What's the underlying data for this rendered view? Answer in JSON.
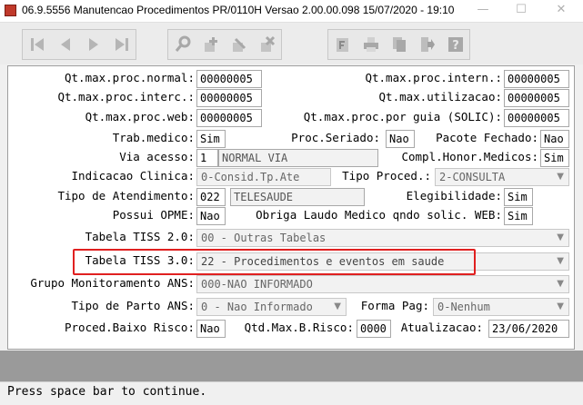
{
  "window": {
    "title": "06.9.5556 Manutencao  Procedimentos PR/0110H Versao 2.00.00.098 15/07/2020 - 19:10",
    "minimize_glyph": "—",
    "maximize_glyph": "☐",
    "close_glyph": "✕"
  },
  "toolbar": {
    "nav_icons": [
      "first-icon",
      "previous-icon",
      "next-icon",
      "last-icon"
    ],
    "edit_icons": [
      "search-icon",
      "add-icon",
      "edit-icon",
      "delete-icon"
    ],
    "action_icons": [
      "filter-icon",
      "print-icon",
      "copy-icon",
      "exit-icon",
      "help-icon"
    ]
  },
  "form": {
    "qt_max_normal": {
      "label": "Qt.max.proc.normal:",
      "value": "00000005"
    },
    "qt_max_intern": {
      "label": "Qt.max.proc.intern.:",
      "value": "00000005"
    },
    "qt_max_interc": {
      "label": "Qt.max.proc.interc.:",
      "value": "00000005"
    },
    "qt_max_utilizacao": {
      "label": "Qt.max.utilizacao:",
      "value": "00000005"
    },
    "qt_max_web": {
      "label": "Qt.max.proc.web:",
      "value": "00000005"
    },
    "qt_max_guia": {
      "label": "Qt.max.proc.por guia (SOLIC):",
      "value": "00000005"
    },
    "trab_medico": {
      "label": "Trab.medico:",
      "value": "Sim"
    },
    "proc_seriado": {
      "label": "Proc.Seriado:",
      "value": "Nao"
    },
    "pacote_fechado": {
      "label": "Pacote Fechado:",
      "value": "Nao"
    },
    "via_acesso": {
      "label": "Via acesso:",
      "code": "1",
      "desc": "NORMAL VIA"
    },
    "compl_honor": {
      "label": "Compl.Honor.Medicos:",
      "value": "Sim"
    },
    "indicacao_clinica": {
      "label": "Indicacao Clinica:",
      "value": "0-Consid.Tp.Ate"
    },
    "tipo_proced": {
      "label": "Tipo Proced.:",
      "value": "2-CONSULTA"
    },
    "tipo_atendimento": {
      "label": "Tipo de Atendimento:",
      "code": "022",
      "desc": "TELESAUDE"
    },
    "elegibilidade": {
      "label": "Elegibilidade:",
      "value": "Sim"
    },
    "possui_opme": {
      "label": "Possui OPME:",
      "value": "Nao"
    },
    "obriga_laudo": {
      "label": "Obriga Laudo Medico qndo solic. WEB:",
      "value": "Sim"
    },
    "tabela_tiss2": {
      "label": "Tabela TISS 2.0:",
      "value": "00 - Outras Tabelas"
    },
    "tabela_tiss3": {
      "label": "Tabela TISS 3.0:",
      "value": "22 - Procedimentos e eventos em saude"
    },
    "grupo_monitoramento": {
      "label": "Grupo Monitoramento ANS:",
      "value": "000-NAO INFORMADO"
    },
    "tipo_parto": {
      "label": "Tipo de Parto ANS:",
      "value": "0 - Nao Informado"
    },
    "forma_pag": {
      "label": "Forma Pag:",
      "value": "0-Nenhum"
    },
    "proced_baixo_risco": {
      "label": "Proced.Baixo Risco:",
      "value": "Nao"
    },
    "qtd_max_b_risco": {
      "label": "Qtd.Max.B.Risco:",
      "value": "0000"
    },
    "atualizacao": {
      "label": "Atualizacao:",
      "value": "23/06/2020"
    }
  },
  "status_bar": {
    "message": "Press space bar to continue."
  },
  "colors": {
    "highlight": "#e02020",
    "strip": "#9a9a9a",
    "title_icon": "#c0392b"
  }
}
